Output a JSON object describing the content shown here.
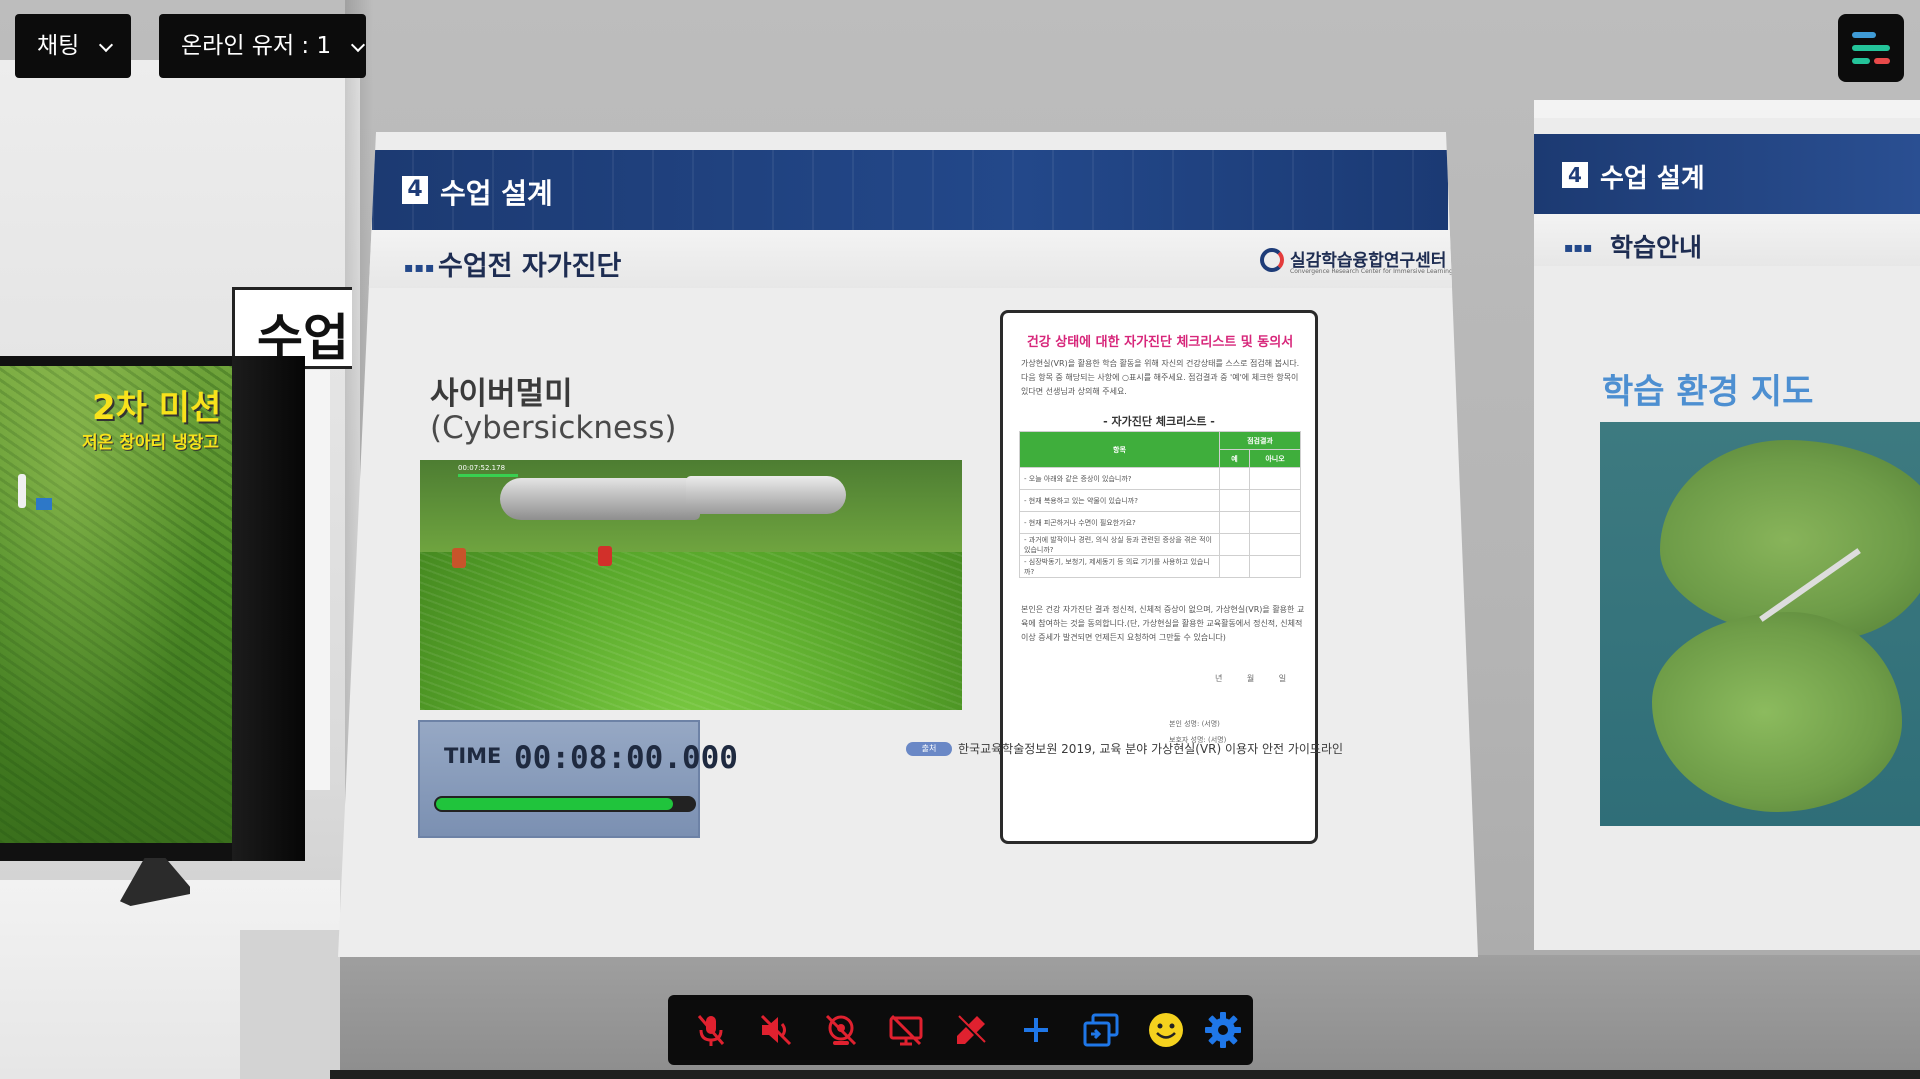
{
  "top_bar": {
    "chat_dropdown": "채팅",
    "online_users": "온라인 유저 : 1"
  },
  "menu_button": {
    "icon": "menu-icon",
    "colors": [
      "#3f9bd6",
      "#24c49a",
      "#e84a4a"
    ]
  },
  "scene": {
    "sign_text": "수업",
    "tv_title": "2차 미션",
    "tv_subtitle": "저온 창아리 냉장고"
  },
  "main_slide": {
    "section_number": "4",
    "section_title": "수업 설계",
    "subtitle_dots": "▪▪▪",
    "subtitle": "수업전 자가진단",
    "org_name": "실감학습융합연구센터",
    "org_subname": "Convergence Research Center for Immersive Learning Technology",
    "topic_title": "사이버멀미",
    "topic_en": "(Cybersickness)",
    "game_hud": "00:07:52.178",
    "time_label": "TIME",
    "time_value": "00:08:00.000",
    "time_progress": 0.92,
    "checklist": {
      "title": "건강 상태에 대한 자가진단 체크리스트 및 동의서",
      "intro": "가상현실(VR)을 활용한 학습 활동을 위해 자신의 건강상태를 스스로 점검해 봅시다. 다음 항목 중 해당되는 사항에 ○표시를 해주세요. 점검결과 중 '예'에 체크한 항목이 있다면 선생님과 상의해 주세요.",
      "section": "- 자가진단 체크리스트 -",
      "col_item": "항목",
      "col_result": "점검결과",
      "col_yes": "예",
      "col_no": "아니오",
      "rows": [
        "- 오늘 아래와 같은 증상이 있습니까?",
        "- 현재 복용하고 있는 약물이 있습니까?",
        "- 현재 피곤하거나 수면이 필요한가요?",
        "- 과거에 발작이나 경련, 의식 상실 등과 관련된 증상을 겪은 적이 있습니까?",
        "- 심장박동기, 보청기, 제세동기 등 의료 기기를 사용하고 있습니까?"
      ],
      "consent": "본인은 건강 자가진단 결과 정신적, 신체적 증상이 없으며, 가상현실(VR)을 활용한 교육에 참여하는 것을 동의합니다.(단, 가상현실을 활용한 교육활동에서 정신적, 신체적 이상 증세가 발견되면 언제든지 요청하여 그만둘 수 있습니다)",
      "date": "년 월 일",
      "sign_self": "본인 성명: (서명)",
      "sign_guardian": "보호자 성명: (서명)"
    },
    "source_label": "출처",
    "source_text": "한국교육학술정보원 2019, 교육 분야 가상현실(VR) 이용자 안전 가이드라인"
  },
  "right_slide": {
    "section_number": "4",
    "section_title": "수업 설계",
    "subtitle_dots": "▪▪▪",
    "subtitle": "학습안내",
    "map_title": "학습 환경 지도"
  },
  "toolbar": {
    "buttons": [
      {
        "name": "mic-off-button",
        "icon": "mic-off-icon",
        "color": "#e0212f"
      },
      {
        "name": "speaker-off-button",
        "icon": "speaker-off-icon",
        "color": "#e0212f"
      },
      {
        "name": "camera-off-button",
        "icon": "camera-off-icon",
        "color": "#e0212f"
      },
      {
        "name": "screen-share-off-button",
        "icon": "screen-share-off-icon",
        "color": "#e0212f"
      },
      {
        "name": "pen-off-button",
        "icon": "pen-off-icon",
        "color": "#e0212f"
      },
      {
        "name": "add-button",
        "icon": "plus-icon",
        "color": "#1f77e8"
      },
      {
        "name": "switch-view-button",
        "icon": "switch-view-icon",
        "color": "#1f77e8"
      },
      {
        "name": "emoji-button",
        "icon": "smile-icon",
        "color": "#f5d21e"
      },
      {
        "name": "settings-button",
        "icon": "gear-icon",
        "color": "#1f77e8"
      }
    ]
  }
}
